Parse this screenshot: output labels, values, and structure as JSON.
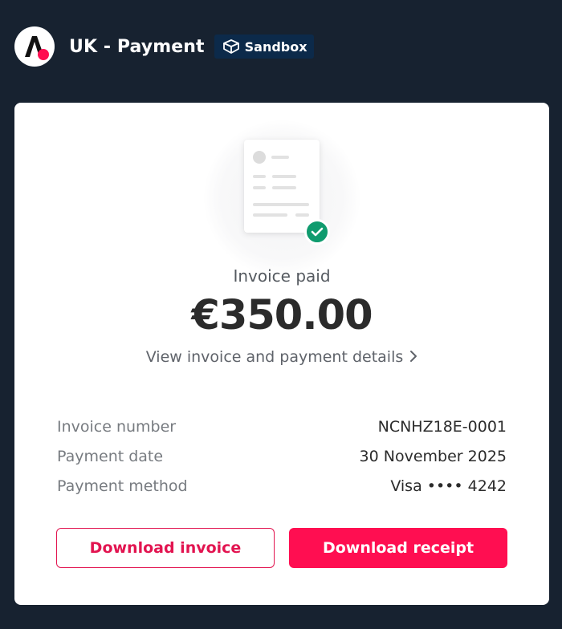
{
  "header": {
    "merchant_name": "UK - Payment",
    "sandbox_label": "Sandbox"
  },
  "status": {
    "label": "Invoice paid",
    "amount": "€350.00",
    "details_link": "View invoice and payment details"
  },
  "details": [
    {
      "label": "Invoice number",
      "value": "NCNHZ18E-0001"
    },
    {
      "label": "Payment date",
      "value": "30 November 2025"
    },
    {
      "label": "Payment method",
      "value": "Visa •••• 4242"
    }
  ],
  "actions": {
    "download_invoice": "Download invoice",
    "download_receipt": "Download receipt"
  },
  "colors": {
    "background": "#172230",
    "accent": "#ff0e51",
    "success": "#0f9b6e",
    "badge": "#0c2a4a"
  },
  "icons": {
    "logo": "brand-logo-icon",
    "sandbox": "cube-icon",
    "document": "document-icon",
    "success": "check-circle-icon",
    "chevron": "chevron-right-icon"
  }
}
